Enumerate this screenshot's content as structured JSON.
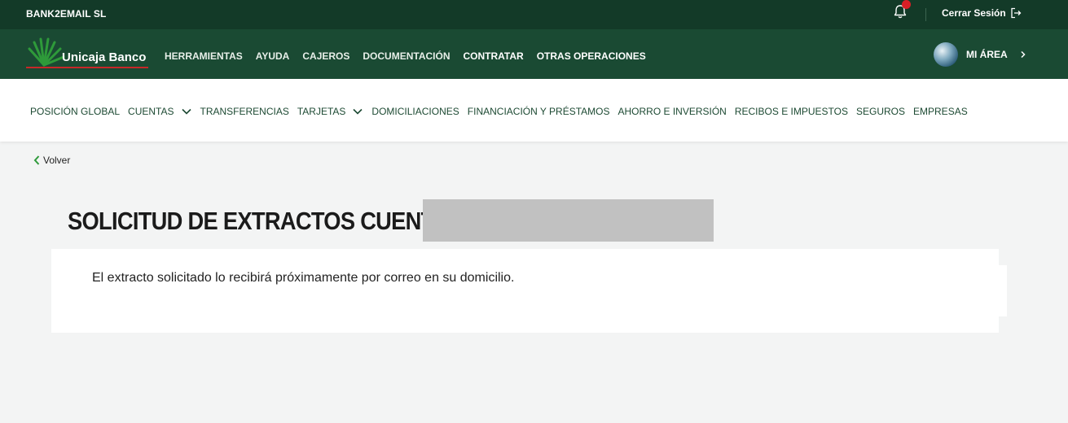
{
  "topbar": {
    "company": "BANK2EMAIL SL",
    "logout_label": "Cerrar Sesión",
    "icons": [
      "bell-icon",
      "logout-icon"
    ]
  },
  "brandbar": {
    "logo_text": "Unicaja Banco",
    "nav": [
      {
        "label": "HERRAMIENTAS"
      },
      {
        "label": "AYUDA"
      },
      {
        "label": "CAJEROS"
      },
      {
        "label": "DOCUMENTACIÓN"
      },
      {
        "label": "CONTRATAR"
      },
      {
        "label": "OTRAS OPERACIONES"
      }
    ],
    "area_label": "MI ÁREA"
  },
  "mainnav": {
    "items": [
      {
        "label": "POSICIÓN GLOBAL"
      },
      {
        "label": "CUENTAS"
      },
      {
        "label": "TRANSFERENCIAS"
      },
      {
        "label": "TARJETAS"
      },
      {
        "label": "DOMICILIACIONES"
      },
      {
        "label": "FINANCIACIÓN Y PRÉSTAMOS"
      },
      {
        "label": "AHORRO E INVERSIÓN"
      },
      {
        "label": "RECIBOS E IMPUESTOS"
      },
      {
        "label": "SEGUROS"
      },
      {
        "label": "EMPRESAS"
      }
    ]
  },
  "back_label": "Volver",
  "page": {
    "title": "SOLICITUD DE EXTRACTOS CUENTA:",
    "message": "El extracto solicitado lo recibirá próximamente por correo en su domicilio."
  },
  "colors": {
    "topbar": "#133a28",
    "brandbar": "#1a4a33",
    "nav_text": "#1d4a33",
    "notification": "#d81f26",
    "logo_green": "#2e9a3a",
    "logo_red": "#c62828"
  }
}
